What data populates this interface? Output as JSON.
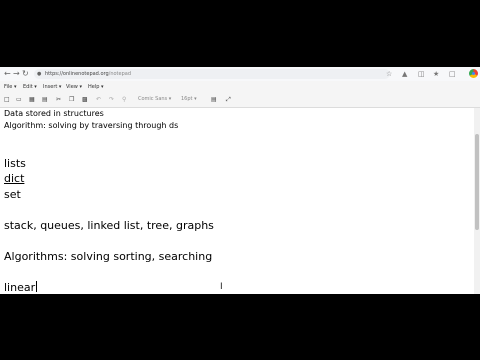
{
  "browser": {
    "url_domain": "https://onlinenotepad.org",
    "url_path": "/notepad",
    "back_icon": "arrow-left",
    "forward_icon": "arrow-right",
    "reload_icon": "reload"
  },
  "menu": {
    "items": [
      {
        "label": "File"
      },
      {
        "label": "Edit"
      },
      {
        "label": "Insert"
      },
      {
        "label": "View"
      },
      {
        "label": "Help"
      }
    ]
  },
  "toolbar": {
    "font_family": "Comic Sans",
    "font_size": "16pt"
  },
  "document": {
    "lines": [
      "Data stored in structures",
      "Algorithm: solving by traversing through ds",
      "lists",
      "dict",
      "set",
      "stack, queues, linked list, tree, graphs",
      "Algorithms: solving sorting, searching",
      "linear"
    ]
  }
}
